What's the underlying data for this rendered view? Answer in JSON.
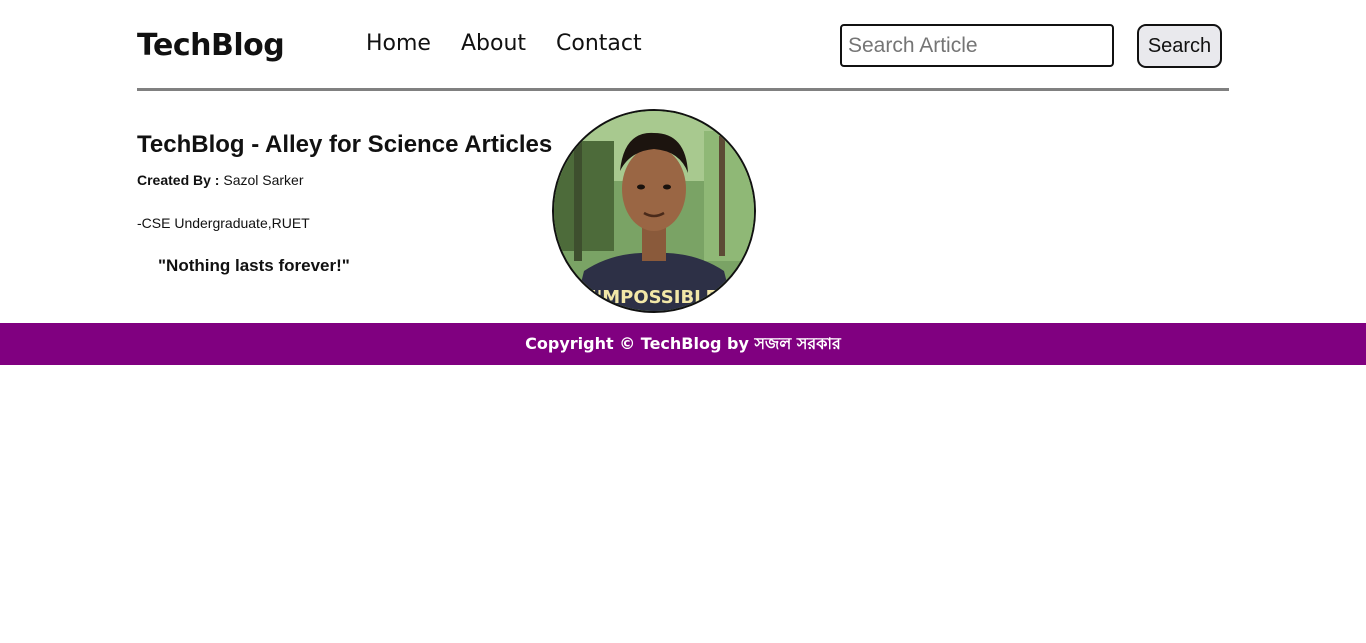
{
  "header": {
    "logo": "TechBlog",
    "nav": [
      {
        "label": "Home"
      },
      {
        "label": "About"
      },
      {
        "label": "Contact"
      }
    ],
    "search": {
      "placeholder": "Search Article",
      "button_label": "Search"
    }
  },
  "main": {
    "title": "TechBlog - Alley for Science Articles",
    "created_by_label": "Created By :",
    "author": "Sazol Sarker",
    "degree": "-CSE Undergraduate,RUET",
    "quote": "\"Nothing lasts forever!\"",
    "avatar": {
      "shirt_text": "I'MPOSSIBLE"
    }
  },
  "footer": {
    "text": "Copyright © TechBlog by সজল সরকার"
  },
  "colors": {
    "footer_bg": "#800080",
    "divider": "#808080",
    "button_bg": "#e9e9ed"
  }
}
